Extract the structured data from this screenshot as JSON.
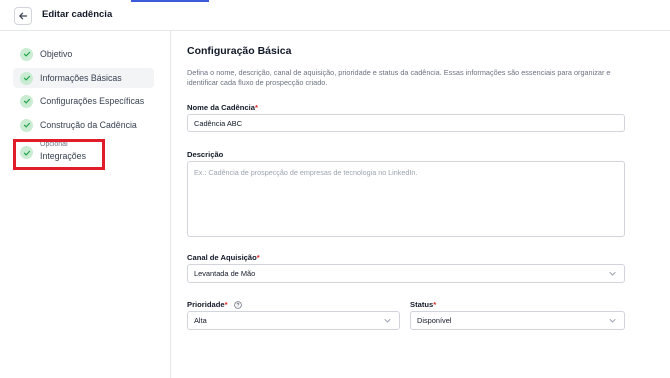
{
  "header": {
    "title": "Editar cadência",
    "back_icon": "arrow-left-icon"
  },
  "sidebar": {
    "steps": [
      {
        "label": "Objetivo",
        "status": "done"
      },
      {
        "label": "Informações Básicas",
        "status": "done",
        "active": true
      },
      {
        "label": "Configurações Específicas",
        "status": "done"
      },
      {
        "label": "Construção da Cadência",
        "status": "done"
      },
      {
        "label": "Integrações",
        "optional_label": "Opcional",
        "status": "done"
      }
    ]
  },
  "main": {
    "title": "Configuração Básica",
    "description": "Defina o nome, descrição, canal de aquisição, prioridade e status da cadência. Essas informações são essenciais para organizar e identificar cada fluxo de prospecção criado.",
    "fields": {
      "name": {
        "label": "Nome da Cadência",
        "required_mark": "*",
        "value": "Cadência ABC"
      },
      "description": {
        "label": "Descrição",
        "placeholder": "Ex.: Cadência de prospecção de empresas de tecnologia no LinkedIn."
      },
      "channel": {
        "label": "Canal de Aquisição",
        "required_mark": "*",
        "value": "Levantada de Mão"
      },
      "priority": {
        "label": "Prioridade",
        "required_mark": "*",
        "value": "Alta",
        "help_icon": "help-circle-icon"
      },
      "status": {
        "label": "Status",
        "required_mark": "*",
        "value": "Disponível"
      }
    }
  },
  "colors": {
    "accent": "#3b5bdb",
    "check_bg": "#c9ecd3",
    "check_fg": "#22a24a",
    "highlight": "#e11d2a",
    "required": "#dc2626"
  }
}
